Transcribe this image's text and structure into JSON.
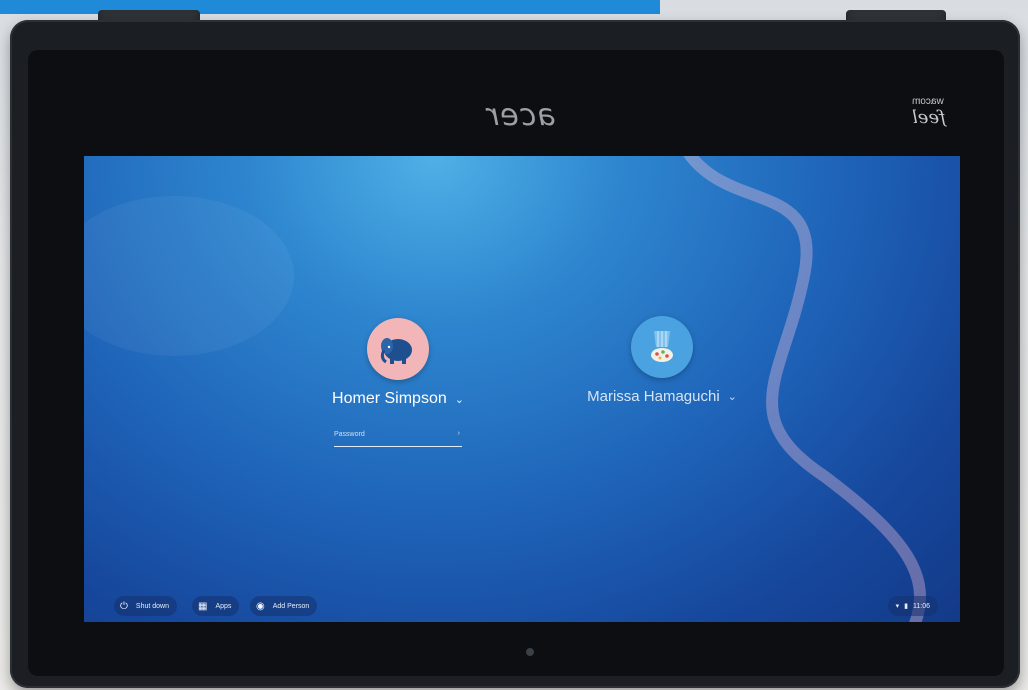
{
  "device": {
    "brand": "acer",
    "stylus_brand_top": "wacom",
    "stylus_brand_sub": "feel"
  },
  "login": {
    "users": [
      {
        "name": "Homer Simpson",
        "avatar_icon": "elephant-icon",
        "avatar_bg": "#f2b5b8",
        "selected": true
      },
      {
        "name": "Marissa Hamaguchi",
        "avatar_icon": "ice-cream-icon",
        "avatar_bg": "#4aa3e0",
        "selected": false
      }
    ],
    "password_placeholder": "Password"
  },
  "shelf": {
    "shutdown_label": "Shut down",
    "apps_label": "Apps",
    "add_person_label": "Add Person"
  },
  "tray": {
    "time": "11:06"
  },
  "colors": {
    "screen_top": "#4fb0e6",
    "screen_bottom": "#133a88",
    "banner": "#1f8ad8"
  }
}
